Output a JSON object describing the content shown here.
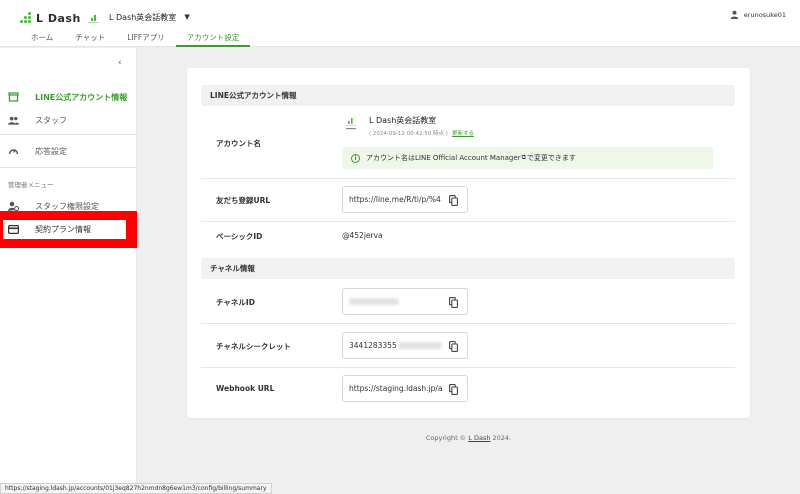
{
  "header": {
    "logo_text": "L Dash",
    "account_name": "L Dash英会話教室",
    "user_name": "erunosuke01",
    "tabs": [
      {
        "label": "ホーム"
      },
      {
        "label": "チャット"
      },
      {
        "label": "LIFFアプリ"
      },
      {
        "label": "アカウント設定",
        "active": true
      }
    ]
  },
  "sidebar": {
    "collapse_glyph": "‹",
    "items": [
      {
        "label": "LINE公式アカウント情報",
        "active": true
      },
      {
        "label": "スタッフ"
      },
      {
        "label": "応答設定"
      }
    ],
    "section_label": "管理者メニュー",
    "admin_items": [
      {
        "label": "スタッフ権限設定"
      },
      {
        "label": "契約プラン情報"
      }
    ]
  },
  "line_section": {
    "title": "LINE公式アカウント情報",
    "account_label": "アカウント名",
    "account_name": "L Dash英会話教室",
    "account_updated": "( 2024-09-12 00:42:50 時点 )",
    "update_link": "更新する",
    "info_prefix": "アカウント名は",
    "info_link": "LINE Official Account Manager",
    "info_suffix": "で変更できます",
    "friend_url_label": "友だち登録URL",
    "friend_url_value": "https://line.me/R/ti/p/%4",
    "basic_id_label": "ベーシックID",
    "basic_id_value": "@452jerva"
  },
  "channel_section": {
    "title": "チャネル情報",
    "channel_id_label": "チャネルID",
    "channel_secret_label": "チャネルシークレット",
    "channel_secret_value": "3441283355",
    "webhook_label": "Webhook URL",
    "webhook_value": "https://staging.ldash.jp/a"
  },
  "footer": {
    "prefix": "Copyright © ",
    "brand": "L Dash",
    "suffix": " 2024."
  },
  "status_url": "https://staging.ldash.jp/accounts/01j3eq827h2nmdn8g6ew1m3/config/billing/summary",
  "colors": {
    "brand_green": "#3e9b32",
    "highlight_red": "#ff0000",
    "info_bg": "#eef7ea"
  }
}
